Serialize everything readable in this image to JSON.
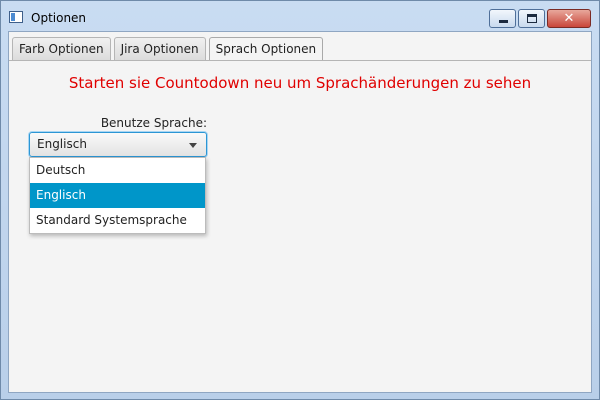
{
  "window": {
    "title": "Optionen",
    "app_icon": "app-window-icon",
    "controls": {
      "minimize": "minimize-icon",
      "maximize": "maximize-icon",
      "close": "close-icon",
      "close_glyph": "✕"
    }
  },
  "tabs": [
    {
      "label": "Farb Optionen",
      "active": false
    },
    {
      "label": "Jira Optionen",
      "active": false
    },
    {
      "label": "Sprach Optionen",
      "active": true
    }
  ],
  "content": {
    "warning": "Starten sie Countodown neu um Sprachänderungen zu sehen",
    "language_label": "Benutze Sprache:",
    "language_combo": {
      "value": "Englisch",
      "arrow_icon": "chevron-down-icon",
      "options": [
        {
          "label": "Deutsch",
          "selected": false
        },
        {
          "label": "Englisch",
          "selected": true
        },
        {
          "label": "Standard Systemsprache",
          "selected": false
        }
      ]
    }
  },
  "colors": {
    "warning_text": "#e00000",
    "selection": "#0096c9",
    "focus": "#2c96d4"
  }
}
